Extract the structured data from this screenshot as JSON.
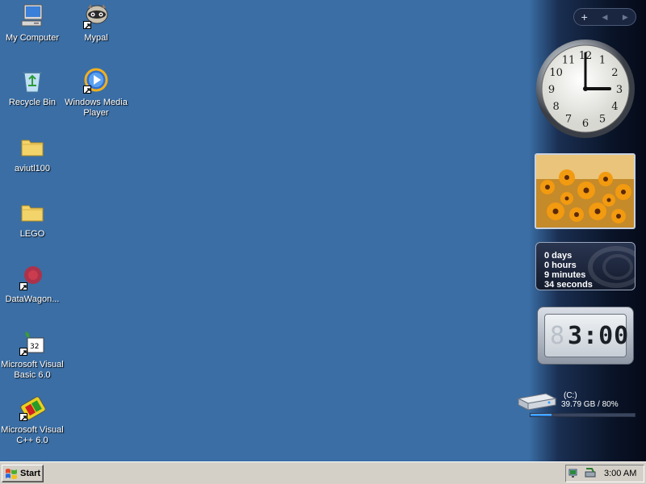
{
  "desktop": {
    "icons": [
      {
        "label": "My Computer",
        "icon": "my-computer-icon"
      },
      {
        "label": "Mypal",
        "icon": "mypal-raccoon-icon"
      },
      {
        "label": "Recycle Bin",
        "icon": "recycle-bin-icon"
      },
      {
        "label": "Windows Media Player",
        "icon": "windows-media-player-icon"
      },
      {
        "label": "aviutl100",
        "icon": "folder-icon"
      },
      {
        "label": "LEGO",
        "icon": "folder-icon"
      },
      {
        "label": "DataWagon...",
        "icon": "datawagon-icon"
      },
      {
        "label": "Microsoft Visual Basic 6.0",
        "icon": "visual-basic-icon"
      },
      {
        "label": "Microsoft Visual C++ 6.0",
        "icon": "visual-cpp-icon"
      }
    ]
  },
  "sidebar": {
    "controls": {
      "add": "+",
      "prev": "◀",
      "next": "▶"
    },
    "clock": {
      "hour": 3,
      "minute": 0
    },
    "uptime": {
      "days": "0 days",
      "hours": "0 hours",
      "minutes": "9 minutes",
      "seconds": "34 seconds"
    },
    "digital_clock": {
      "ghost": "8",
      "time": "3:00"
    },
    "drive": {
      "name": "(C:)",
      "info": "39.79 GB / 80%",
      "used_fraction": 0.2
    }
  },
  "taskbar": {
    "start_label": "Start",
    "clock": "3:00 AM"
  },
  "colors": {
    "desktop_bg": "#3a6ea5",
    "taskbar_bg": "#d4d0c8"
  }
}
